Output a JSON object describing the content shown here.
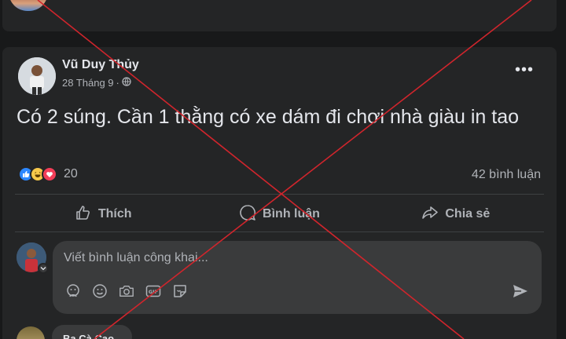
{
  "previous_post": {
    "text": ""
  },
  "post": {
    "author": "Vũ Duy Thủy",
    "date": "28 Tháng 9",
    "privacy_icon": "globe-icon",
    "more_icon": "more-icon",
    "more_label": "•••",
    "content": "Có 2 súng. Cần 1 thằng có xe dám đi chơi nhà giàu in tao",
    "reactions": {
      "types": [
        "like",
        "haha",
        "love"
      ],
      "count": "20"
    },
    "comments_count": "42 bình luận",
    "actions": {
      "like_label": "Thích",
      "comment_label": "Bình luận",
      "share_label": "Chia sẻ"
    },
    "composer": {
      "placeholder": "Viết bình luận công khai...",
      "tools": [
        "sticker-icon",
        "emoji-icon",
        "camera-icon",
        "gif-icon",
        "sticker-alt-icon"
      ],
      "send_icon": "send-icon"
    },
    "next_comment": {
      "author": "Ba Cà Cao"
    }
  },
  "overlay": {
    "type": "red-x",
    "color": "#d0252c"
  }
}
